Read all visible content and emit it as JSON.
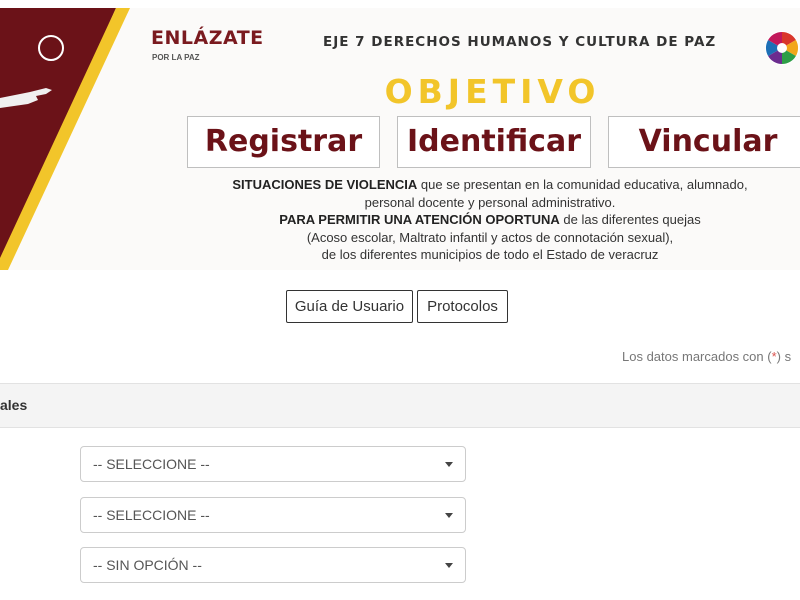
{
  "banner": {
    "logo_title": "ENLÁZATE",
    "logo_sub": "POR LA PAZ",
    "eje": "EJE 7 DERECHOS HUMANOS Y CULTURA DE PAZ",
    "objetivo": "OBJETIVO",
    "words": [
      "Registrar",
      "Identificar",
      "Vincular"
    ],
    "desc_bold1": "SITUACIONES DE VIOLENCIA",
    "desc_text1": " que se presentan en la comunidad educativa, alumnado, personal docente y personal administrativo.",
    "desc_bold2": "PARA PERMITIR UNA ATENCIÓN OPORTUNA",
    "desc_text2": " de las diferentes quejas",
    "desc_text3": "(Acoso escolar, Maltrato infantil y actos de connotación sexual),",
    "desc_text4": "de los diferentes municipios de todo el Estado de veracruz",
    "colors": {
      "maroon": "#6b1218",
      "yellow": "#f2c52a"
    },
    "icons": [
      "circle-icon",
      "hand-icon",
      "flower-logo-icon"
    ]
  },
  "buttons": {
    "guide": "Guía de Usuario",
    "protocols": "Protocolos"
  },
  "note": {
    "prefix": "Los datos marcados con (",
    "star": "*",
    "suffix": ") s"
  },
  "section": {
    "title": "ales"
  },
  "selects": [
    {
      "value": "-- SELECCIONE --"
    },
    {
      "value": "-- SELECCIONE --"
    },
    {
      "value": "-- SIN OPCIÓN --"
    }
  ]
}
